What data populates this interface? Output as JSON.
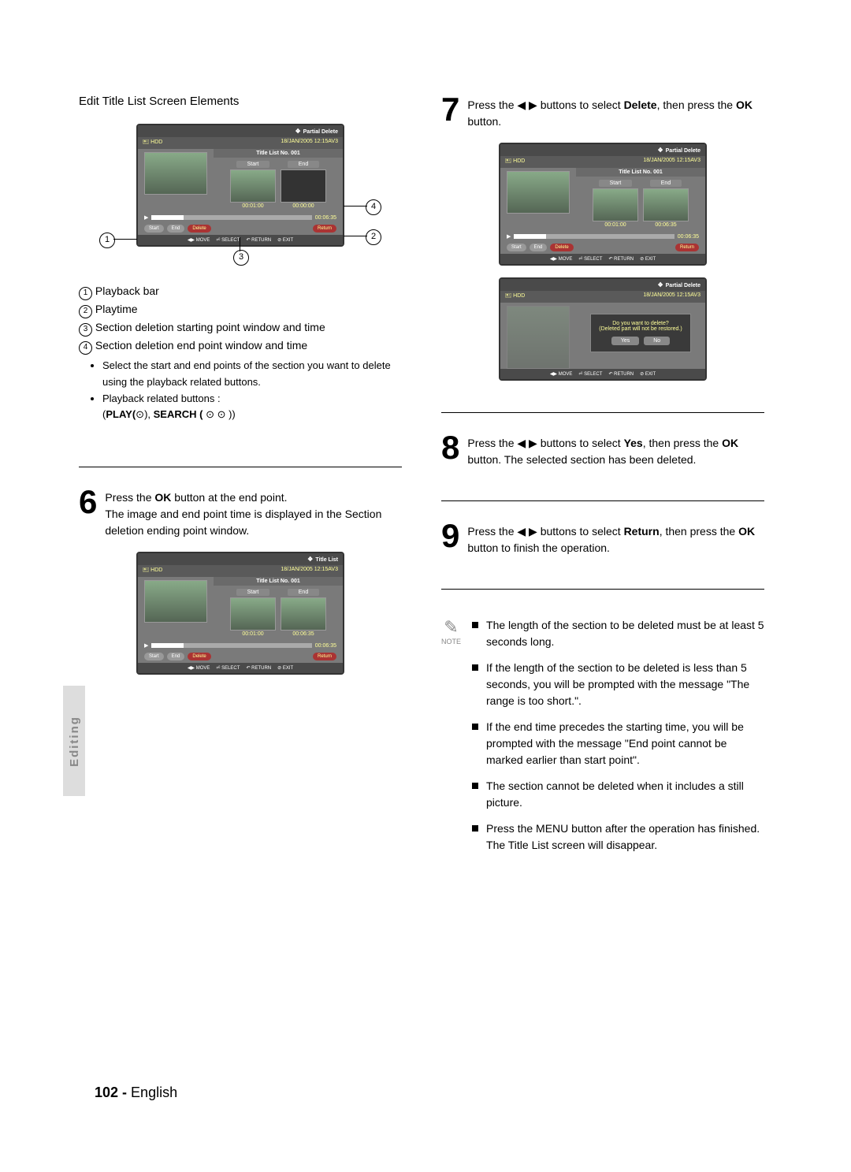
{
  "side_tab": "Editing",
  "page_number": "102 -",
  "page_lang": "English",
  "left": {
    "heading": "Edit Title List Screen Elements",
    "panel1": {
      "header_title": "Partial Delete",
      "hdd": "HDD",
      "date": "18/JAN/2005 12:15AV3",
      "title_no": "Title List No. 001",
      "start": "Start",
      "end": "End",
      "start_time": "00:01:00",
      "end_time": "00:00:00",
      "playtime": "00:06:35",
      "btn_start": "Start",
      "btn_end": "End",
      "btn_delete": "Delete",
      "btn_return": "Return",
      "footer": {
        "move": "MOVE",
        "select": "SELECT",
        "return": "RETURN",
        "exit": "EXIT"
      }
    },
    "callouts": {
      "c1": "1",
      "c2": "2",
      "c3": "3",
      "c4": "4"
    },
    "legend": {
      "l1": "Playback bar",
      "l2": "Playtime",
      "l3": "Section deletion starting point window and time",
      "l4": "Section deletion end point window and time",
      "b1": "Select the start and end points of the section you want to delete using the playback related buttons.",
      "b2": "Playback related buttons :",
      "b3_prefix": "(",
      "b3_play": "PLAY(",
      "b3_mid": "), ",
      "b3_search": "SEARCH ( ",
      "b3_suffix": " ))"
    },
    "step6": {
      "num": "6",
      "line1a": "Press the ",
      "line1b": "OK",
      "line1c": " button at the end point.",
      "line2": "The image and end point time is displayed in the Section deletion ending point window."
    },
    "panel2": {
      "header_title": "Title List",
      "hdd": "HDD",
      "date": "18/JAN/2005 12:15AV3",
      "title_no": "Title List No. 001",
      "start": "Start",
      "end": "End",
      "start_time": "00:01:00",
      "end_time": "00:06:35",
      "playtime": "00:06:35",
      "btn_start": "Start",
      "btn_end": "End",
      "btn_delete": "Delete",
      "btn_return": "Return",
      "footer": {
        "move": "MOVE",
        "select": "SELECT",
        "return": "RETURN",
        "exit": "EXIT"
      }
    }
  },
  "right": {
    "step7": {
      "num": "7",
      "a": "Press the ",
      "arrows": "◀ ▶",
      "b": " buttons to select ",
      "delete": "Delete",
      "c": ", then press the ",
      "ok": "OK",
      "d": " button."
    },
    "panel3": {
      "header_title": "Partial Delete",
      "hdd": "HDD",
      "date": "18/JAN/2005 12:15AV3",
      "title_no": "Title List No. 001",
      "start": "Start",
      "end": "End",
      "start_time": "00:01:00",
      "end_time": "00:06:35",
      "playtime": "00:06:35",
      "btn_start": "Start",
      "btn_end": "End",
      "btn_delete": "Delete",
      "btn_return": "Return",
      "footer": {
        "move": "MOVE",
        "select": "SELECT",
        "return": "RETURN",
        "exit": "EXIT"
      }
    },
    "panel4": {
      "header_title": "Partial Delete",
      "hdd": "HDD",
      "date": "18/JAN/2005 12:15AV3",
      "dlg_l1": "Do you want to delete?",
      "dlg_l2": "(Deleted part will not be restored.)",
      "yes": "Yes",
      "no": "No",
      "footer": {
        "move": "MOVE",
        "select": "SELECT",
        "return": "RETURN",
        "exit": "EXIT"
      }
    },
    "step8": {
      "num": "8",
      "a": "Press the ",
      "arrows": "◀ ▶",
      "b": " buttons to select ",
      "yes": "Yes",
      "c": ", then press the ",
      "ok": "OK",
      "d": " button. The selected section has been deleted."
    },
    "step9": {
      "num": "9",
      "a": "Press the ",
      "arrows": "◀ ▶",
      "b": " buttons to select ",
      "return": "Return",
      "c": ", then press the ",
      "ok": "OK",
      "d": " button to finish the operation."
    },
    "note_label": "NOTE",
    "notes": {
      "n1": "The length of the section to be deleted must be at least 5 seconds long.",
      "n2": "If the length of the section to be deleted is less than 5 seconds, you will be prompted with the message \"The range is too short.\".",
      "n3": "If the end time precedes the starting time, you will be prompted with the message \"End point cannot be marked earlier than start point\".",
      "n4": "The section cannot be deleted when it includes a still picture.",
      "n5a": "Press the ",
      "n5menu": "MENU",
      "n5b": " button after the operation has finished.",
      "n5c": "The Title List screen will disappear."
    }
  }
}
